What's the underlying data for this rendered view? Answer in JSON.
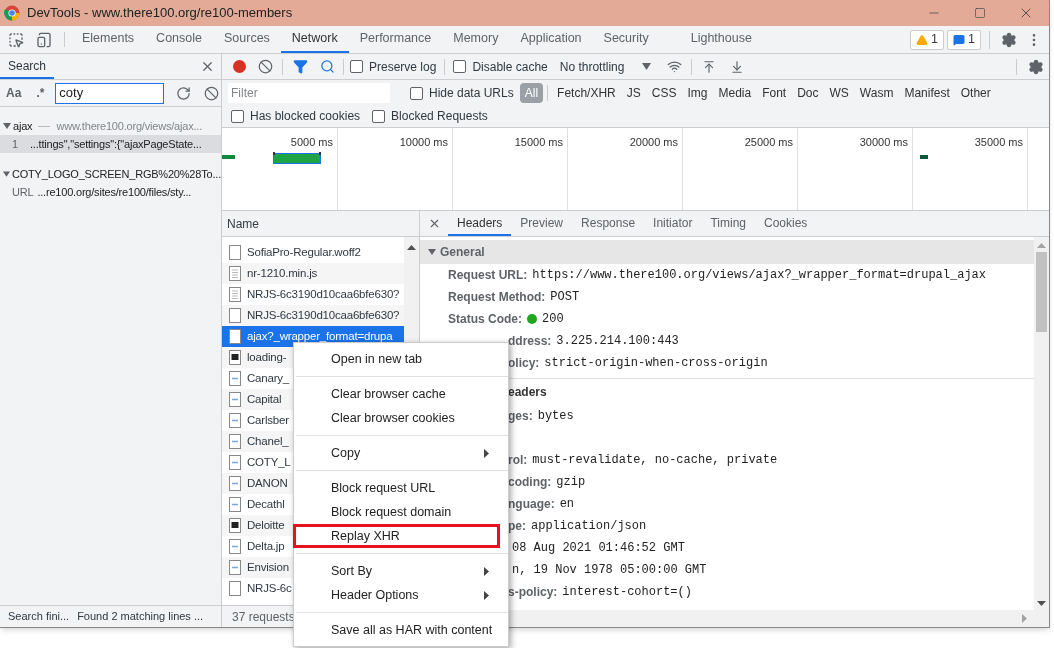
{
  "window": {
    "title": "DevTools - www.there100.org/re100-members"
  },
  "main_tabs": [
    {
      "label": "Elements",
      "selected": false
    },
    {
      "label": "Console",
      "selected": false
    },
    {
      "label": "Sources",
      "selected": false
    },
    {
      "label": "Network",
      "selected": true
    },
    {
      "label": "Performance",
      "selected": false
    },
    {
      "label": "Memory",
      "selected": false
    },
    {
      "label": "Application",
      "selected": false
    },
    {
      "label": "Security",
      "selected": false
    },
    {
      "label": "Lighthouse",
      "selected": false
    }
  ],
  "badges": {
    "warnings": "1",
    "messages": "1"
  },
  "search_panel": {
    "tab": {
      "label": "Search",
      "selected": true
    },
    "case_toggle": "Aa",
    "regex_toggle": ".*",
    "query": "coty",
    "results": [
      {
        "file": "ajax",
        "url": "www.there100.org/views/ajax...",
        "matches": [
          {
            "line": "1",
            "text": "...ttings\",\"settings\":{\"ajaxPageState...",
            "selected": true
          }
        ]
      },
      {
        "file": "COTY_LOGO_SCREEN_RGB%20%28To...",
        "matches": [
          {
            "line": "URL",
            "text": "...re100.org/sites/re100/files/sty...",
            "selected": false
          }
        ]
      }
    ],
    "status": [
      "Search fini...",
      "Found 2 matching lines ..."
    ]
  },
  "toolbar": {
    "preserve_log": {
      "label": "Preserve log",
      "checked": false
    },
    "disable_cache": {
      "label": "Disable cache",
      "checked": false
    },
    "throttling": "No throttling"
  },
  "filter": {
    "placeholder": "Filter",
    "hide_data_urls": {
      "label": "Hide data URLs",
      "checked": false
    },
    "types": [
      {
        "label": "All",
        "selected": true
      },
      {
        "label": "Fetch/XHR",
        "selected": false
      },
      {
        "label": "JS",
        "selected": false
      },
      {
        "label": "CSS",
        "selected": false
      },
      {
        "label": "Img",
        "selected": false
      },
      {
        "label": "Media",
        "selected": false
      },
      {
        "label": "Font",
        "selected": false
      },
      {
        "label": "Doc",
        "selected": false
      },
      {
        "label": "WS",
        "selected": false
      },
      {
        "label": "Wasm",
        "selected": false
      },
      {
        "label": "Manifest",
        "selected": false
      },
      {
        "label": "Other",
        "selected": false
      }
    ],
    "has_blocked_cookies": {
      "label": "Has blocked cookies",
      "checked": false
    },
    "blocked_requests": {
      "label": "Blocked Requests",
      "checked": false
    }
  },
  "timeline": {
    "ticks": [
      "5000 ms",
      "10000 ms",
      "15000 ms",
      "20000 ms",
      "25000 ms",
      "30000 ms",
      "35000 ms"
    ]
  },
  "requests": {
    "header": "Name",
    "rows": [
      {
        "name": "SofiaPro-Regular.woff2",
        "kind": "file",
        "selected": false
      },
      {
        "name": "nr-1210.min.js",
        "kind": "script",
        "selected": false
      },
      {
        "name": "NRJS-6c3190d10caa6bfe630?",
        "kind": "script",
        "selected": false
      },
      {
        "name": "NRJS-6c3190d10caa6bfe630?",
        "kind": "file",
        "selected": false
      },
      {
        "name": "ajax?_wrapper_format=drupa",
        "kind": "file",
        "selected": true
      },
      {
        "name": "loading-",
        "kind": "image-dark",
        "selected": false
      },
      {
        "name": "Canary_",
        "kind": "image",
        "selected": false
      },
      {
        "name": "Capital",
        "kind": "image",
        "selected": false
      },
      {
        "name": "Carlsber",
        "kind": "image",
        "selected": false
      },
      {
        "name": "Chanel_",
        "kind": "image",
        "selected": false
      },
      {
        "name": "COTY_L",
        "kind": "image",
        "selected": false
      },
      {
        "name": "DANON",
        "kind": "image",
        "selected": false
      },
      {
        "name": "Decathl",
        "kind": "image",
        "selected": false
      },
      {
        "name": "Deloitte",
        "kind": "image-dark",
        "selected": false
      },
      {
        "name": "Delta.jp",
        "kind": "image",
        "selected": false
      },
      {
        "name": "Envision",
        "kind": "image",
        "selected": false
      },
      {
        "name": "NRJS-6c",
        "kind": "file",
        "selected": false
      }
    ],
    "summary": "37 requests"
  },
  "details": {
    "tabs": [
      {
        "label": "Headers",
        "selected": true
      },
      {
        "label": "Preview",
        "selected": false
      },
      {
        "label": "Response",
        "selected": false
      },
      {
        "label": "Initiator",
        "selected": false
      },
      {
        "label": "Timing",
        "selected": false
      },
      {
        "label": "Cookies",
        "selected": false
      }
    ],
    "general": {
      "title": "General",
      "expanded": true,
      "rows": [
        {
          "name": "Request URL:",
          "value": "https://www.there100.org/views/ajax?_wrapper_format=drupal_ajax",
          "kind": "full"
        },
        {
          "name": "Request Method:",
          "value": "POST",
          "kind": "full"
        },
        {
          "name": "Status Code:",
          "value": "200",
          "kind": "status",
          "color": "#1fa81f"
        },
        {
          "name": "ddress:",
          "value": "3.225.214.100:443",
          "kind": "partial"
        },
        {
          "name": "olicy:",
          "value": "strict-origin-when-cross-origin",
          "kind": "partial"
        }
      ]
    },
    "response": {
      "title": "eaders",
      "rows": [
        {
          "name": "ges:",
          "value": "bytes",
          "kind": "partial"
        },
        {
          "name": "rol:",
          "value": "must-revalidate, no-cache, private",
          "kind": "partial"
        },
        {
          "name": "coding:",
          "value": "gzip",
          "kind": "partial"
        },
        {
          "name": "nguage:",
          "value": "en",
          "kind": "partial"
        },
        {
          "name": "pe:",
          "value": "application/json",
          "kind": "partial"
        },
        {
          "value": "08 Aug 2021 01:46:52 GMT",
          "kind": "value-only"
        },
        {
          "value": "n, 19 Nov 1978 05:00:00 GMT",
          "kind": "value-only"
        },
        {
          "name": "s-policy:",
          "value": "interest-cohort=()",
          "kind": "partial"
        }
      ]
    }
  },
  "context_menu": [
    {
      "kind": "item",
      "label": "Open in new tab",
      "submenu": false,
      "highlighted": false
    },
    {
      "kind": "separator"
    },
    {
      "kind": "item",
      "label": "Clear browser cache",
      "submenu": false,
      "highlighted": false
    },
    {
      "kind": "item",
      "label": "Clear browser cookies",
      "submenu": false,
      "highlighted": false
    },
    {
      "kind": "separator"
    },
    {
      "kind": "item",
      "label": "Copy",
      "submenu": true,
      "highlighted": false
    },
    {
      "kind": "separator"
    },
    {
      "kind": "item",
      "label": "Block request URL",
      "submenu": false,
      "highlighted": false
    },
    {
      "kind": "item",
      "label": "Block request domain",
      "submenu": false,
      "highlighted": false
    },
    {
      "kind": "item",
      "label": "Replay XHR",
      "submenu": false,
      "highlighted": true
    },
    {
      "kind": "separator"
    },
    {
      "kind": "item",
      "label": "Sort By",
      "submenu": true,
      "highlighted": false
    },
    {
      "kind": "item",
      "label": "Header Options",
      "submenu": true,
      "highlighted": false
    },
    {
      "kind": "separator"
    },
    {
      "kind": "item",
      "label": "Save all as HAR with content",
      "submenu": false,
      "highlighted": false
    }
  ]
}
